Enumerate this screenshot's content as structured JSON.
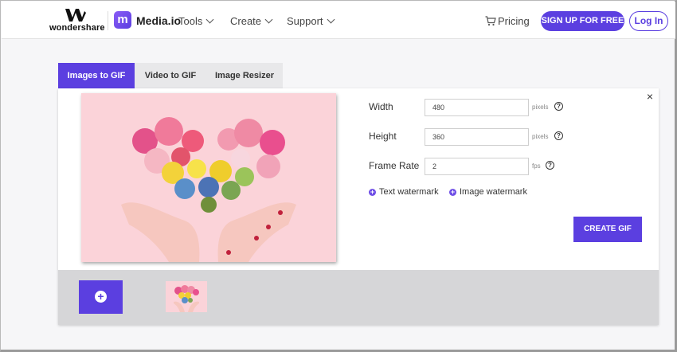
{
  "header": {
    "brand": "wondershare",
    "product_mark": "m",
    "product": "Media.io",
    "nav": [
      {
        "label": "Tools"
      },
      {
        "label": "Create"
      },
      {
        "label": "Support"
      }
    ],
    "pricing": "Pricing",
    "signup": "SIGN UP FOR FREE",
    "login": "Log In"
  },
  "tabs": [
    {
      "label": "Images to GIF",
      "active": true
    },
    {
      "label": "Video to GIF",
      "active": false
    },
    {
      "label": "Image Resizer",
      "active": false
    }
  ],
  "form": {
    "width_label": "Width",
    "width_value": "480",
    "width_unit": "pixels",
    "height_label": "Height",
    "height_value": "360",
    "height_unit": "pixels",
    "framerate_label": "Frame Rate",
    "framerate_value": "2",
    "framerate_unit": "fps",
    "help": "?"
  },
  "watermark": {
    "text": "Text watermark",
    "image": "Image watermark"
  },
  "create_button": "CREATE GIF",
  "close": "×",
  "add_symbol": "+",
  "colors": {
    "accent": "#5b3fe0",
    "preview_bg": "#fbd3d9"
  }
}
